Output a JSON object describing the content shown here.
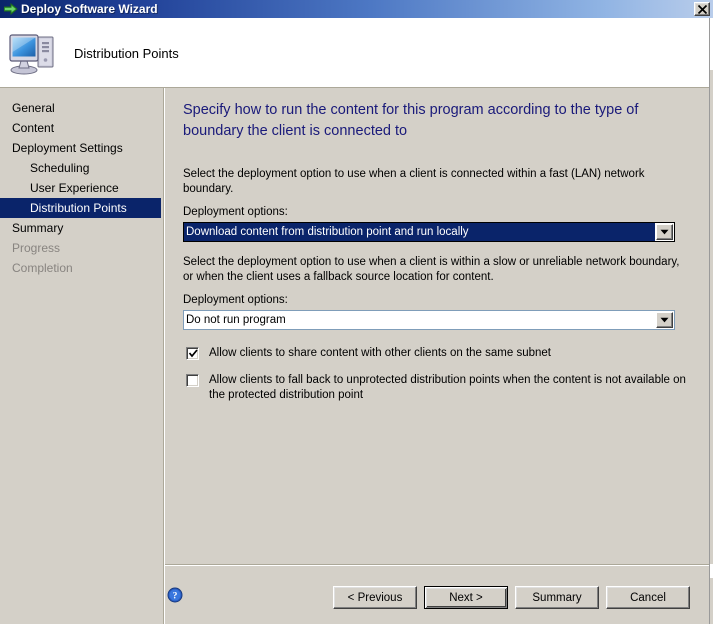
{
  "window": {
    "title": "Deploy Software Wizard",
    "title_icon": "green-arrow-icon",
    "close_label": "Close"
  },
  "header": {
    "icon": "computer-icon",
    "title": "Distribution Points"
  },
  "sidebar": {
    "items": [
      {
        "label": "General",
        "state": "normal",
        "indent": false
      },
      {
        "label": "Content",
        "state": "normal",
        "indent": false
      },
      {
        "label": "Deployment Settings",
        "state": "normal",
        "indent": false
      },
      {
        "label": "Scheduling",
        "state": "normal",
        "indent": true
      },
      {
        "label": "User Experience",
        "state": "normal",
        "indent": true
      },
      {
        "label": "Distribution Points",
        "state": "selected",
        "indent": true
      },
      {
        "label": "Summary",
        "state": "normal",
        "indent": false
      },
      {
        "label": "Progress",
        "state": "disabled",
        "indent": false
      },
      {
        "label": "Completion",
        "state": "disabled",
        "indent": false
      }
    ]
  },
  "content": {
    "heading": "Specify how to run the content for this program according to the type of boundary the client is connected to",
    "fast_boundary": {
      "description": "Select the deployment option to use when a client is connected within a fast (LAN) network boundary.",
      "label": "Deployment options:",
      "selected": "Download content from distribution point and run locally"
    },
    "slow_boundary": {
      "description": "Select the deployment option to use when a client is within a slow or unreliable network boundary, or when the client uses a fallback source location for content.",
      "label": "Deployment options:",
      "selected": "Do not run program"
    },
    "checkboxes": [
      {
        "label": "Allow clients to share content with other clients on the same subnet",
        "checked": true
      },
      {
        "label": "Allow clients to fall back to unprotected distribution points when the content is not available on the protected distribution point",
        "checked": false
      }
    ]
  },
  "footer": {
    "help_icon": "help-icon",
    "buttons": [
      {
        "label": "< Previous",
        "default": false
      },
      {
        "label": "Next >",
        "default": true
      },
      {
        "label": "Summary",
        "default": false
      },
      {
        "label": "Cancel",
        "default": false
      }
    ]
  },
  "colors": {
    "title_gradient_start": "#0a246a",
    "title_gradient_end": "#b9cdeb",
    "dialog_face": "#d4d0c8",
    "heading_text": "#1a1a7a",
    "selection_blue": "#0a246a",
    "disabled_text": "#888480"
  }
}
